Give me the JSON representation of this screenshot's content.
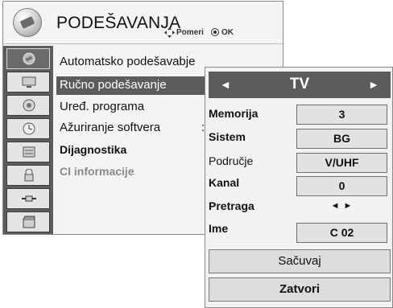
{
  "menu": {
    "title": "PODEŠAVANJA",
    "hint_move": "Pomeri",
    "hint_ok": "OK",
    "items": [
      "Automatsko podešavabje",
      "Ručno podešavanje",
      "Uređ. programa",
      "Ažuriranje softvera",
      "Dijagnostika",
      "CI informacije"
    ],
    "software_update_colon": ": l",
    "sidebar_icons": [
      "setup-icon",
      "picture-icon",
      "audio-icon",
      "time-icon",
      "option-icon",
      "lock-icon",
      "input-icon",
      "usb-icon"
    ]
  },
  "manual_tuning": {
    "title": "TV",
    "fields": [
      {
        "label": "Memorija",
        "value": "3"
      },
      {
        "label": "Sistem",
        "value": "BG"
      },
      {
        "label": "Područje",
        "value": "V/UHF"
      },
      {
        "label": "Kanal",
        "value": "0"
      },
      {
        "label": "Pretraga",
        "value": "◄ ►"
      },
      {
        "label": "Ime",
        "value": "C  02"
      }
    ],
    "save_button": "Sačuvaj",
    "close_button": "Zatvori"
  },
  "colors": {
    "highlight": "#5c5c5c",
    "panel": "#f4f4f4",
    "field": "#e2e2e2"
  }
}
